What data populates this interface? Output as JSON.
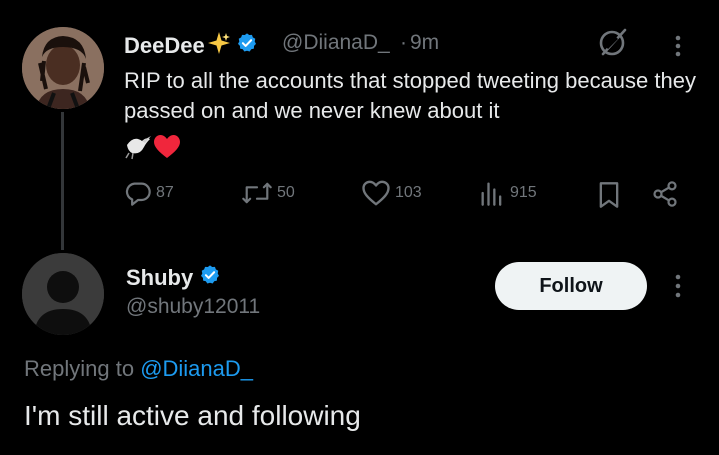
{
  "original_tweet": {
    "author_name": "DeeDee",
    "author_handle": "@DiianaD_",
    "separator": "·",
    "time_ago": "9m",
    "text": "RIP to all the accounts that stopped tweeting because they passed on and we never knew about it",
    "emojis": [
      "dove",
      "red-heart"
    ],
    "replies_count": "87",
    "retweets_count": "50",
    "likes_count": "103",
    "views_count": "915"
  },
  "reply": {
    "author_name": "Shuby",
    "author_handle": "@shuby12011",
    "follow_label": "Follow",
    "replying_prefix": "Replying to ",
    "replying_to": "@DiianaD_",
    "text": "I'm still active and following"
  },
  "colors": {
    "background": "#000000",
    "text_primary": "#e7e9ea",
    "text_secondary": "#71767b",
    "verified_blue": "#1d9bf0",
    "follow_bg": "#eff3f4"
  },
  "icons": {
    "verified": "verified-badge-icon",
    "sparkle": "star-sparkle-icon",
    "grok": "grok-icon",
    "more": "more-vertical-icon",
    "reply": "reply-icon",
    "retweet": "retweet-icon",
    "like": "heart-icon",
    "views": "views-icon",
    "bookmark": "bookmark-icon",
    "share": "share-icon"
  }
}
